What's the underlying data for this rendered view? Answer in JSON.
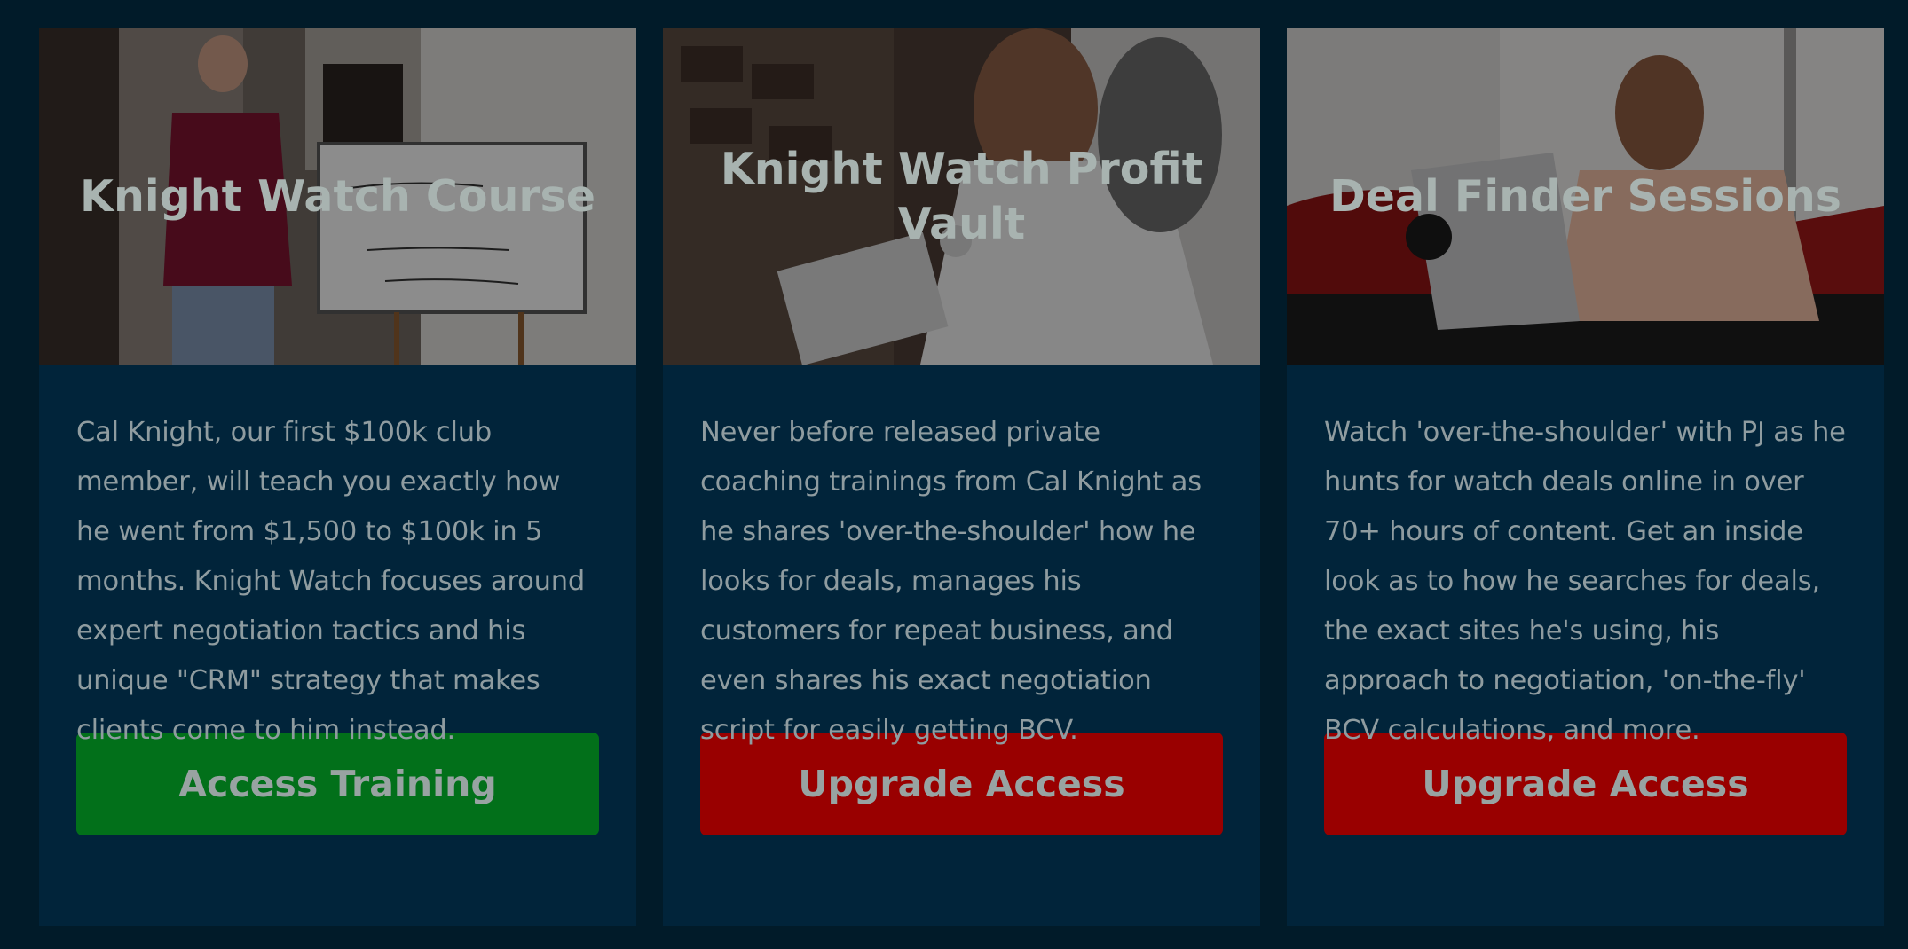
{
  "colors": {
    "page_background": "#011b29",
    "card_background": "#01243a",
    "access_button": "#02701a",
    "upgrade_button": "#990000"
  },
  "cards": [
    {
      "title": "Knight Watch Course",
      "image_icon": "presenter-whiteboard-photo",
      "description": "Cal Knight, our first $100k club member, will teach you exactly how he went from $1,500 to $100k in 5 months. Knight Watch focuses around expert negotiation tactics and his unique \"CRM\" strategy that makes clients come to him instead.",
      "button_label": "Access Training"
    },
    {
      "title": "Knight Watch Profit Vault",
      "image_icon": "coaching-laptop-photo",
      "description": "Never before released private coaching trainings from Cal Knight as he shares 'over-the-shoulder' how he looks for deals, manages his customers for repeat business, and even shares his exact negotiation script for easily getting BCV.",
      "button_label": "Upgrade Access"
    },
    {
      "title": "Deal Finder Sessions",
      "image_icon": "laptop-deal-search-photo",
      "description": "Watch 'over-the-shoulder' with PJ as he hunts for watch deals online in over 70+ hours of content. Get an inside look as to how he searches for deals, the exact sites he's using, his approach to negotiation, 'on-the-fly' BCV calculations, and more.",
      "button_label": "Upgrade Access"
    }
  ]
}
